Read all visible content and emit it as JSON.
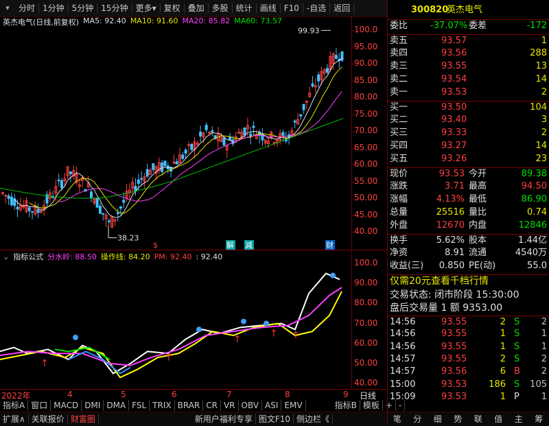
{
  "toolbar": {
    "items": [
      "分时",
      "1分钟",
      "5分钟",
      "15分钟",
      "更多",
      "复权",
      "叠加",
      "多股",
      "统计",
      "画线",
      "F10",
      "自选",
      "返回"
    ]
  },
  "chart_header": {
    "stock_name": "英杰电气",
    "mode": "(日线,前复权)",
    "ma5": "MA5: 92.40",
    "ma10": "MA10: 91.60",
    "ma20": "MA20: 85.82",
    "ma60": "MA60: 73.57",
    "high_label": "99.93",
    "low_label": "38.23",
    "markers": [
      "$",
      "解",
      "減",
      "财"
    ]
  },
  "indicator_header": {
    "name": "指标公式",
    "fsl_label": "分水岭: 88.50",
    "operate_label": "操作线: 84.20",
    "pm_label": "PM: 92.40",
    "extra": ": 92.40"
  },
  "price_axis": [
    "100.0",
    "95.00",
    "90.00",
    "85.00",
    "80.00",
    "75.00",
    "70.00",
    "65.00",
    "60.00",
    "55.00",
    "50.00",
    "45.00",
    "40.00"
  ],
  "indi_axis": [
    "100.0",
    "90.00",
    "80.00",
    "70.00",
    "60.00",
    "50.00",
    "40.00"
  ],
  "date_axis": {
    "labels": [
      "2022年",
      "4",
      "5",
      "6",
      "7",
      "8",
      "9"
    ],
    "period": "日线"
  },
  "bottom_tabs": [
    "指标A",
    "窗口",
    "MACD",
    "DMI",
    "DMA",
    "FSL",
    "TRIX",
    "BRAR",
    "CR",
    "VR",
    "OBV",
    "ASI",
    "EMV",
    "指标B",
    "模板",
    "+",
    "-"
  ],
  "status_bar": [
    "扩展∧",
    "关联报价",
    "财富圈",
    "新用户福利专享",
    "图文F10",
    "侧边栏《"
  ],
  "bottom_icons": [
    "笔",
    "分",
    "细",
    "势",
    "联",
    "值",
    "主",
    "筹"
  ],
  "colors": {
    "up": "#ff4040",
    "down": "#00e000",
    "ma5": "#e0e0e0",
    "ma10": "#e8e800",
    "ma20": "#ff40ff",
    "ma60": "#00c000",
    "accent_yellow": "#e8e800",
    "border": "#7a0000"
  },
  "quote": {
    "code": "300820",
    "name": "英杰电气",
    "weibi_label": "委比",
    "weibi": "-37.07%",
    "weicha_label": "委差",
    "weicha": "-172",
    "sell": [
      {
        "label": "卖五",
        "price": "93.57",
        "vol": "1"
      },
      {
        "label": "卖四",
        "price": "93.56",
        "vol": "288"
      },
      {
        "label": "卖三",
        "price": "93.55",
        "vol": "13"
      },
      {
        "label": "卖二",
        "price": "93.54",
        "vol": "14"
      },
      {
        "label": "卖一",
        "price": "93.53",
        "vol": "2"
      }
    ],
    "buy": [
      {
        "label": "买一",
        "price": "93.50",
        "vol": "104"
      },
      {
        "label": "买二",
        "price": "93.40",
        "vol": "3"
      },
      {
        "label": "买三",
        "price": "93.33",
        "vol": "2"
      },
      {
        "label": "买四",
        "price": "93.27",
        "vol": "14"
      },
      {
        "label": "买五",
        "price": "93.26",
        "vol": "23"
      }
    ],
    "stats": [
      {
        "l1": "现价",
        "v1": "93.53",
        "l2": "今开",
        "v2": "89.38"
      },
      {
        "l1": "涨跌",
        "v1": "3.71",
        "l2": "最高",
        "v2": "94.50"
      },
      {
        "l1": "涨幅",
        "v1": "4.13%",
        "l2": "最低",
        "v2": "86.90"
      },
      {
        "l1": "总量",
        "v1": "25516",
        "l2": "量比",
        "v2": "0.74"
      },
      {
        "l1": "外盘",
        "v1": "12670",
        "l2": "内盘",
        "v2": "12846"
      }
    ],
    "stats2": [
      {
        "l1": "换手",
        "v1": "5.62%",
        "l2": "股本",
        "v2": "1.44亿"
      },
      {
        "l1": "净资",
        "v1": "8.91",
        "l2": "流通",
        "v2": "4540万"
      },
      {
        "l1": "收益(三)",
        "v1": "0.850",
        "l2": "PE(动)",
        "v2": "55.0"
      }
    ],
    "promo": "仅需20元查看千档行情",
    "trade_status": "交易状态: 闭市阶段 15:30:00",
    "after_hours": "盘后交易量 1 额 9353.00",
    "ticks": [
      {
        "time": "14:56",
        "price": "93.55",
        "vol": "2",
        "bs": "S",
        "n": "2"
      },
      {
        "time": "14:56",
        "price": "93.55",
        "vol": "1",
        "bs": "S",
        "n": "1"
      },
      {
        "time": "14:56",
        "price": "93.55",
        "vol": "1",
        "bs": "S",
        "n": "1"
      },
      {
        "time": "14:57",
        "price": "93.55",
        "vol": "2",
        "bs": "S",
        "n": "2"
      },
      {
        "time": "14:57",
        "price": "93.56",
        "vol": "6",
        "bs": "B",
        "n": "2"
      },
      {
        "time": "15:00",
        "price": "93.53",
        "vol": "186",
        "bs": "S",
        "n": "105"
      },
      {
        "time": "15:09",
        "price": "93.53",
        "vol": "1",
        "bs": "P",
        "n": "1"
      }
    ]
  }
}
